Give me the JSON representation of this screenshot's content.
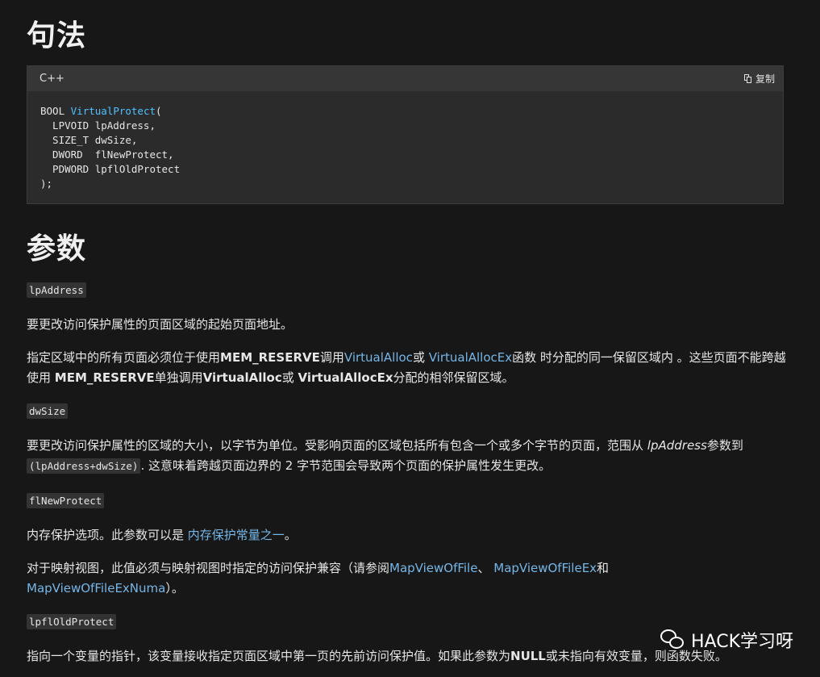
{
  "headings": {
    "syntax": "句法",
    "parameters": "参数"
  },
  "codeblock": {
    "language": "C++",
    "copy_label": "复制",
    "lines": {
      "l1_type": "BOOL ",
      "l1_fn": "VirtualProtect",
      "l1_rest": "(",
      "l2": "  LPVOID lpAddress,",
      "l3": "  SIZE_T dwSize,",
      "l4": "  DWORD  flNewProtect,",
      "l5": "  PDWORD lpflOldProtect",
      "l6": ");"
    }
  },
  "params": {
    "lpAddress": {
      "name": "lpAddress",
      "desc": "要更改访问保护属性的页面区域的起始页面地址。",
      "note_1": "指定区域中的所有页面必须位于使用",
      "note_mem": "MEM_RESERVE",
      "note_2": "调用",
      "note_link1": "VirtualAlloc",
      "note_3": "或 ",
      "note_link2": "VirtualAllocEx",
      "note_4": "函数 时分配的同一保留区域内 。这些页面不能跨越使用 ",
      "note_mem2": "MEM_RESERVE",
      "note_5": "单独调用",
      "note_va": "VirtualAlloc",
      "note_6": "或 ",
      "note_vaex": "VirtualAllocEx",
      "note_7": "分配的相邻保留区域。"
    },
    "dwSize": {
      "name": "dwSize",
      "desc_1": "要更改访问保护属性的区域的大小，以字节为单位。受影响页面的区域包括所有包含一个或多个字节的页面，范围从 ",
      "desc_italic": "lpAddress",
      "desc_2": "参数到 ",
      "desc_code": "(lpAddress+dwSize)",
      "desc_3": ". 这意味着跨越页面边界的 2 字节范围会导致两个页面的保护属性发生更改。"
    },
    "flNewProtect": {
      "name": "flNewProtect",
      "desc_1": "内存保护选项。此参数可以是 ",
      "desc_link": "内存保护常量之一",
      "desc_2": "。",
      "map_1": "对于映射视图，此值必须与映射视图时指定的访问保护兼容（请参阅",
      "map_link1": "MapViewOfFile",
      "map_2": "、 ",
      "map_link2": "MapViewOfFileEx",
      "map_3": "和",
      "map_link3": "MapViewOfFileExNuma",
      "map_4": "）。"
    },
    "lpflOldProtect": {
      "name": "lpflOldProtect",
      "desc_1": "指向一个变量的指针，该变量接收指定页面区域中第一页的先前访问保护值。如果此参数为",
      "desc_null": "NULL",
      "desc_2": "或未指向有效变量，则函数失败。"
    }
  },
  "watermark": {
    "text": "HACK学习呀",
    "icon": "wechat-icon"
  },
  "colors": {
    "background": "#171717",
    "code_bg": "#2b2b2b",
    "code_header": "#363636",
    "link": "#75b6e7",
    "function_name": "#4fc1ff"
  }
}
